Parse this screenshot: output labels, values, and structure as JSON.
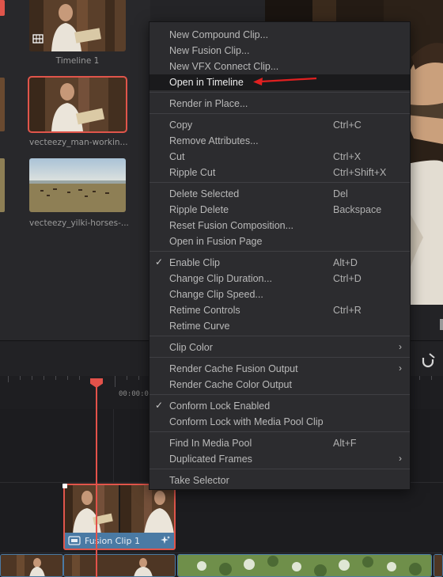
{
  "media_pool": {
    "items": [
      {
        "caption": "Timeline 1"
      },
      {
        "caption": "vecteezy_man-workin..."
      },
      {
        "caption": "vecteezy_yilki-horses-..."
      }
    ]
  },
  "timeline": {
    "timecode": "00:00:0",
    "clip_label": "Fusion Clip 1"
  },
  "context_menu": {
    "items": [
      {
        "label": "New Compound Clip...",
        "shortcut": ""
      },
      {
        "label": "New Fusion Clip...",
        "shortcut": ""
      },
      {
        "label": "New VFX Connect Clip...",
        "shortcut": ""
      },
      {
        "label": "Open in Timeline",
        "shortcut": "",
        "highlighted": true
      },
      {
        "label": "Render in Place...",
        "shortcut": ""
      },
      {
        "label": "Copy",
        "shortcut": "Ctrl+C"
      },
      {
        "label": "Remove Attributes...",
        "shortcut": ""
      },
      {
        "label": "Cut",
        "shortcut": "Ctrl+X"
      },
      {
        "label": "Ripple Cut",
        "shortcut": "Ctrl+Shift+X"
      },
      {
        "label": "Delete Selected",
        "shortcut": "Del"
      },
      {
        "label": "Ripple Delete",
        "shortcut": "Backspace"
      },
      {
        "label": "Reset Fusion Composition...",
        "shortcut": ""
      },
      {
        "label": "Open in Fusion Page",
        "shortcut": ""
      },
      {
        "label": "Enable Clip",
        "shortcut": "Alt+D",
        "checked": true
      },
      {
        "label": "Change Clip Duration...",
        "shortcut": "Ctrl+D"
      },
      {
        "label": "Change Clip Speed...",
        "shortcut": ""
      },
      {
        "label": "Retime Controls",
        "shortcut": "Ctrl+R"
      },
      {
        "label": "Retime Curve",
        "shortcut": ""
      },
      {
        "label": "Clip Color",
        "shortcut": "",
        "submenu": true
      },
      {
        "label": "Render Cache Fusion Output",
        "shortcut": "",
        "submenu": true
      },
      {
        "label": "Render Cache Color Output",
        "shortcut": ""
      },
      {
        "label": "Conform Lock Enabled",
        "shortcut": "",
        "checked": true
      },
      {
        "label": "Conform Lock with Media Pool Clip",
        "shortcut": ""
      },
      {
        "label": "Find In Media Pool",
        "shortcut": "Alt+F"
      },
      {
        "label": "Duplicated Frames",
        "shortcut": "",
        "submenu": true
      },
      {
        "label": "Take Selector",
        "shortcut": ""
      }
    ]
  },
  "colors": {
    "accent_red": "#e3524a",
    "clip_blue": "#4a7aa4",
    "menu_bg": "#2c2c2f",
    "highlight_bg": "#1a1a1c"
  }
}
